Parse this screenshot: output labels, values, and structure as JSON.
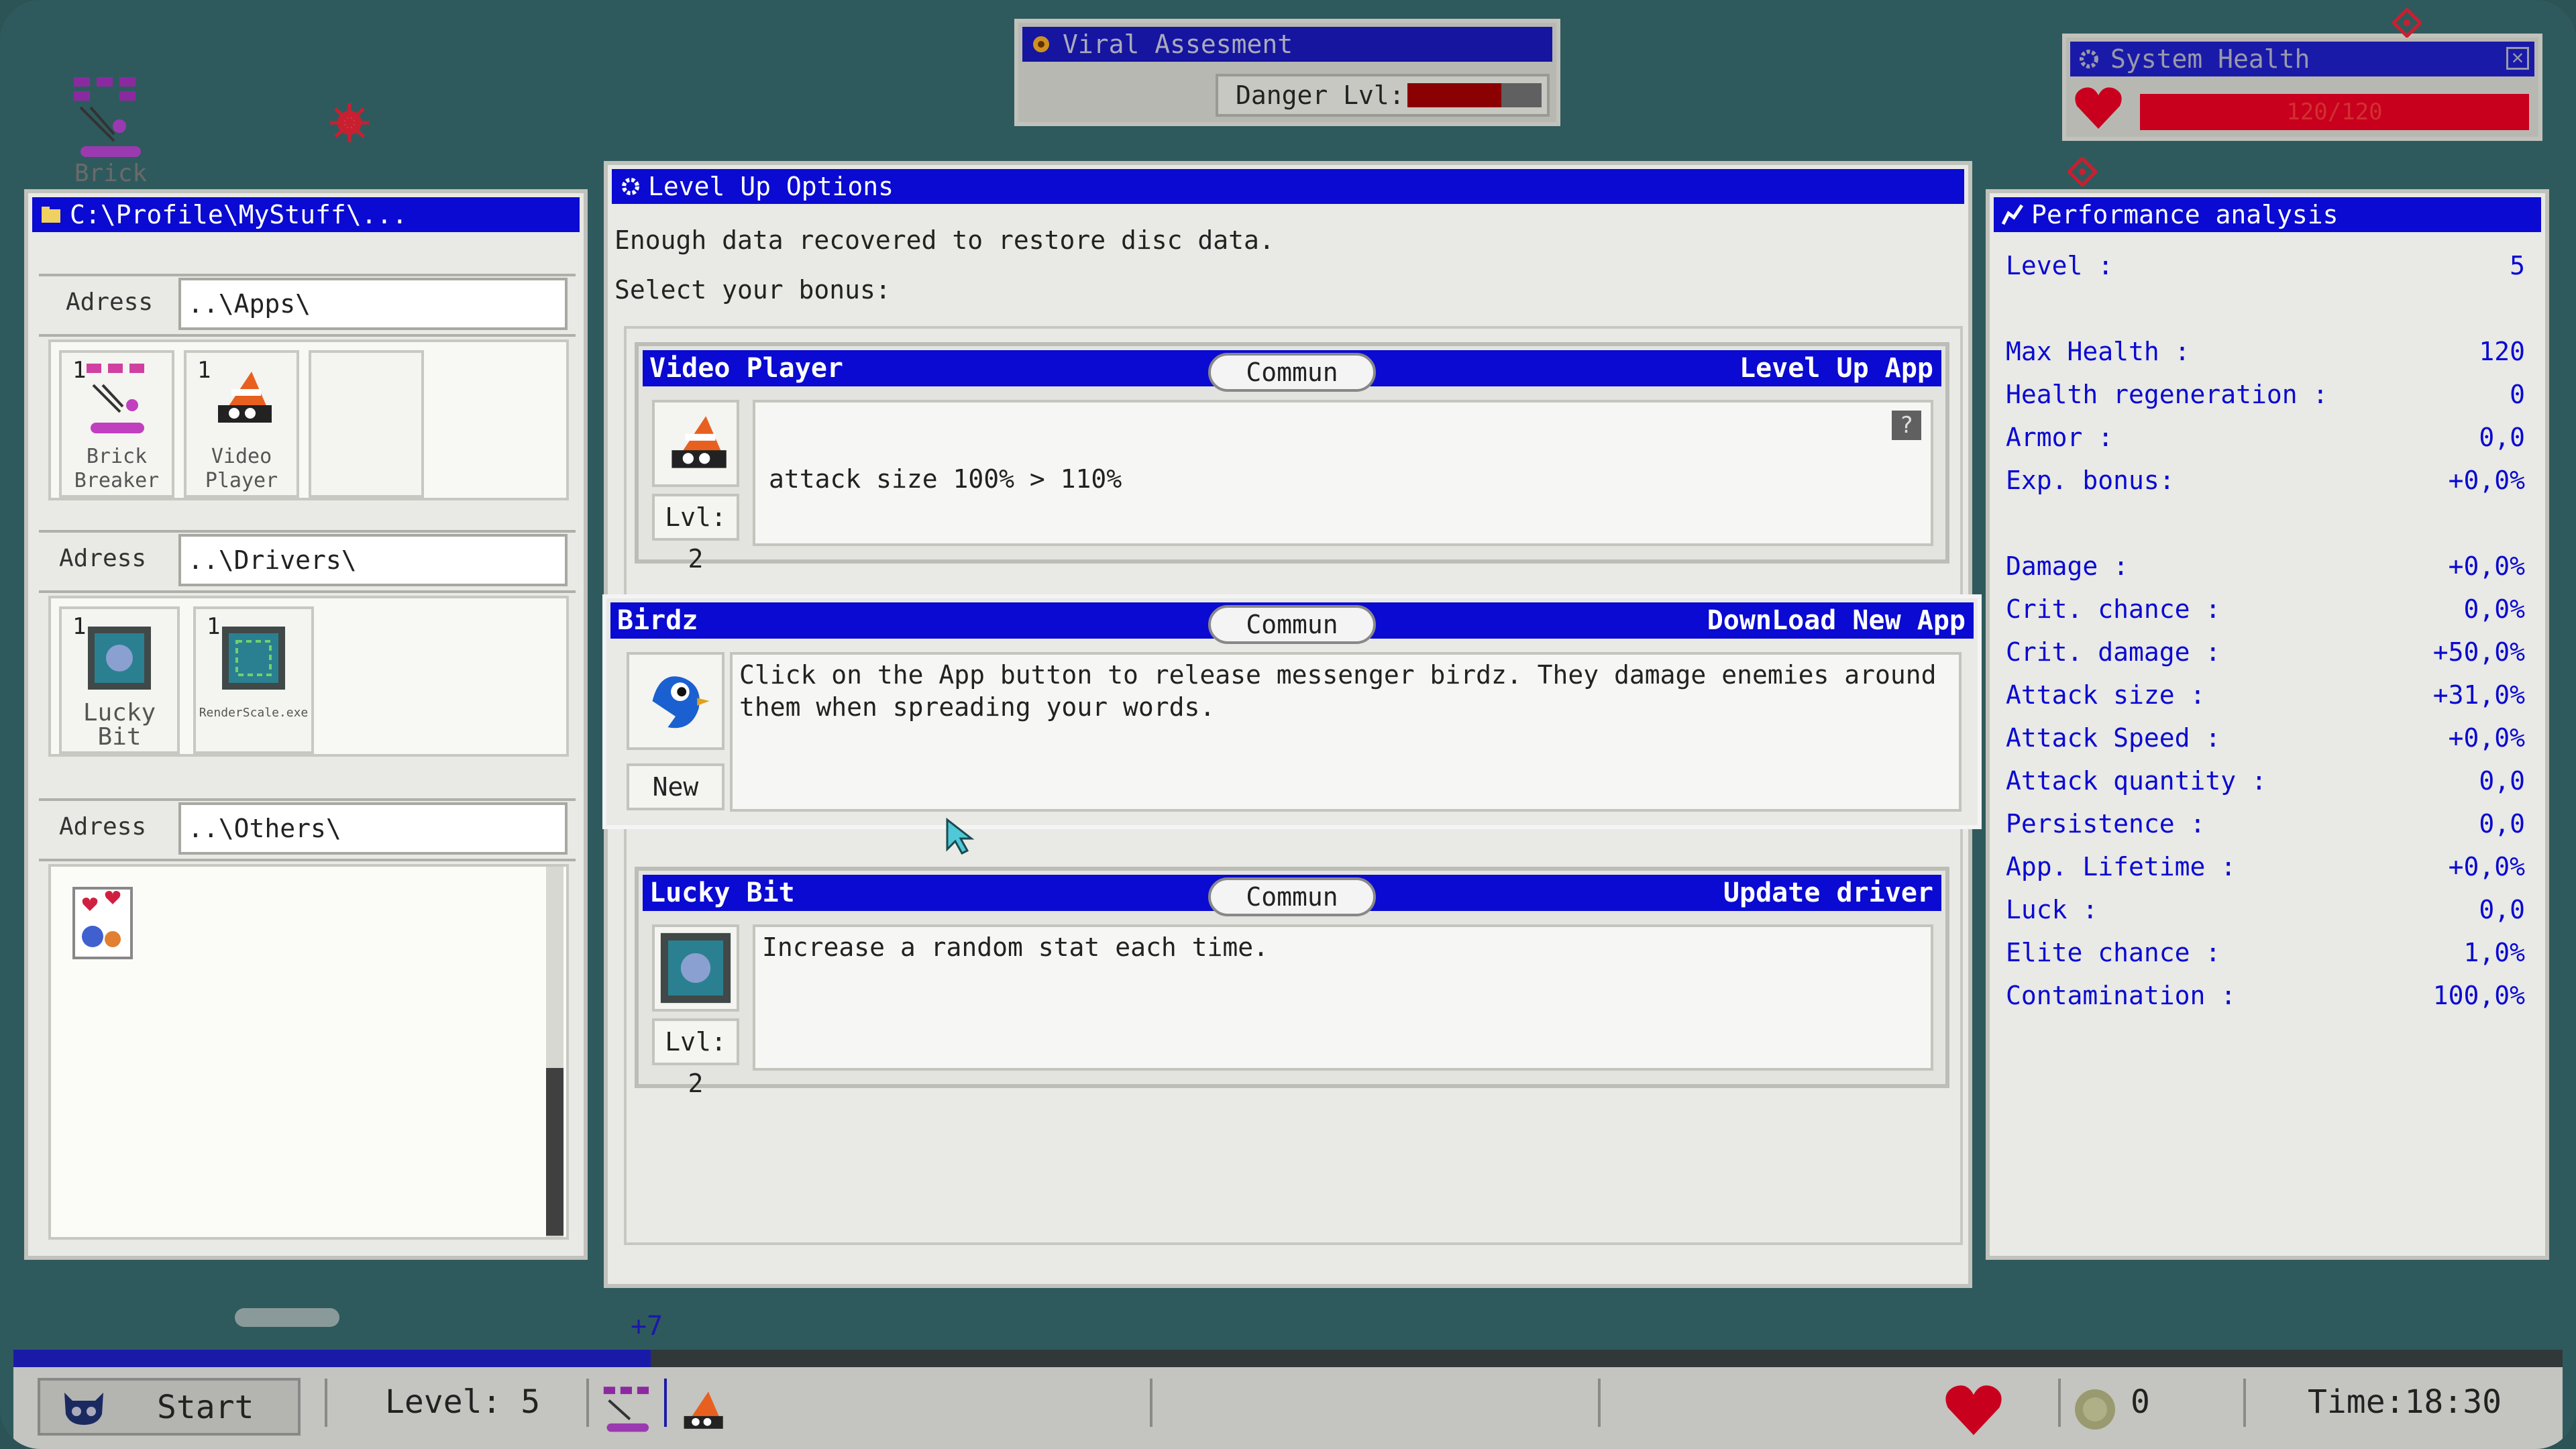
{
  "desktop": {
    "icon_label": "Brick"
  },
  "viral": {
    "title": "Viral Assesment",
    "danger_label": "Danger Lvl:",
    "danger_level": 0.7
  },
  "health": {
    "title": "System Health",
    "value_text": "120/120",
    "fraction": 1.0
  },
  "explorer": {
    "title": "C:\\Profile\\MyStuff\\...",
    "address_label": "Adress",
    "apps_path": "..\\Apps\\",
    "drivers_path": "..\\Drivers\\",
    "others_path": "..\\Others\\",
    "apps": [
      {
        "count": "1",
        "label1": "Brick",
        "label2": "Breaker"
      },
      {
        "count": "1",
        "label1": "Video",
        "label2": "Player"
      }
    ],
    "drivers": [
      {
        "count": "1",
        "label": "Lucky Bit"
      },
      {
        "count": "1",
        "label": "RenderScale.exe"
      }
    ]
  },
  "levelup": {
    "title": "Level Up Options",
    "line1": "Enough data recovered to restore disc data.",
    "line2": "Select your bonus:",
    "cards": [
      {
        "name": "Video Player",
        "rarity": "Commun",
        "type": "Level Up App",
        "desc": "attack size 100% > 110%",
        "level": "Lvl: 2",
        "help": "?"
      },
      {
        "name": "Birdz",
        "rarity": "Commun",
        "type": "DownLoad New App",
        "desc": "Click on the App button to release messenger birdz. They damage enemies around them when spreading your words.",
        "level": "New"
      },
      {
        "name": "Lucky Bit",
        "rarity": "Commun",
        "type": "Update driver",
        "desc": "Increase a random stat each time.",
        "level": "Lvl: 2"
      }
    ]
  },
  "perf": {
    "title": "Performance analysis",
    "group1": [
      {
        "k": "Level :",
        "v": "5"
      }
    ],
    "group2": [
      {
        "k": "Max Health :",
        "v": "120"
      },
      {
        "k": "Health regeneration :",
        "v": "0"
      },
      {
        "k": "Armor :",
        "v": "0,0"
      },
      {
        "k": "Exp. bonus:",
        "v": "+0,0%"
      }
    ],
    "group3": [
      {
        "k": "Damage :",
        "v": "+0,0%"
      },
      {
        "k": "Crit. chance :",
        "v": "0,0%"
      },
      {
        "k": "Crit. damage :",
        "v": "+50,0%"
      },
      {
        "k": "Attack size :",
        "v": "+31,0%"
      },
      {
        "k": "Attack Speed :",
        "v": "+0,0%"
      },
      {
        "k": "Attack quantity :",
        "v": "0,0"
      },
      {
        "k": "Persistence :",
        "v": "0,0"
      },
      {
        "k": "App. Lifetime :",
        "v": "+0,0%"
      },
      {
        "k": "Luck :",
        "v": "0,0"
      },
      {
        "k": "Elite chance :",
        "v": "1,0%"
      },
      {
        "k": "Contamination :",
        "v": "100,0%"
      }
    ]
  },
  "xp": {
    "gain": "+7",
    "progress": 0.25
  },
  "taskbar": {
    "start": "Start",
    "level": "Level: 5",
    "coins": "0",
    "time": "Time:18:30"
  },
  "colors": {
    "title_blue": "#0a0ad2",
    "danger_red": "#8b0000",
    "health_red": "#c8001e",
    "desktop": "#2f5a5d"
  }
}
